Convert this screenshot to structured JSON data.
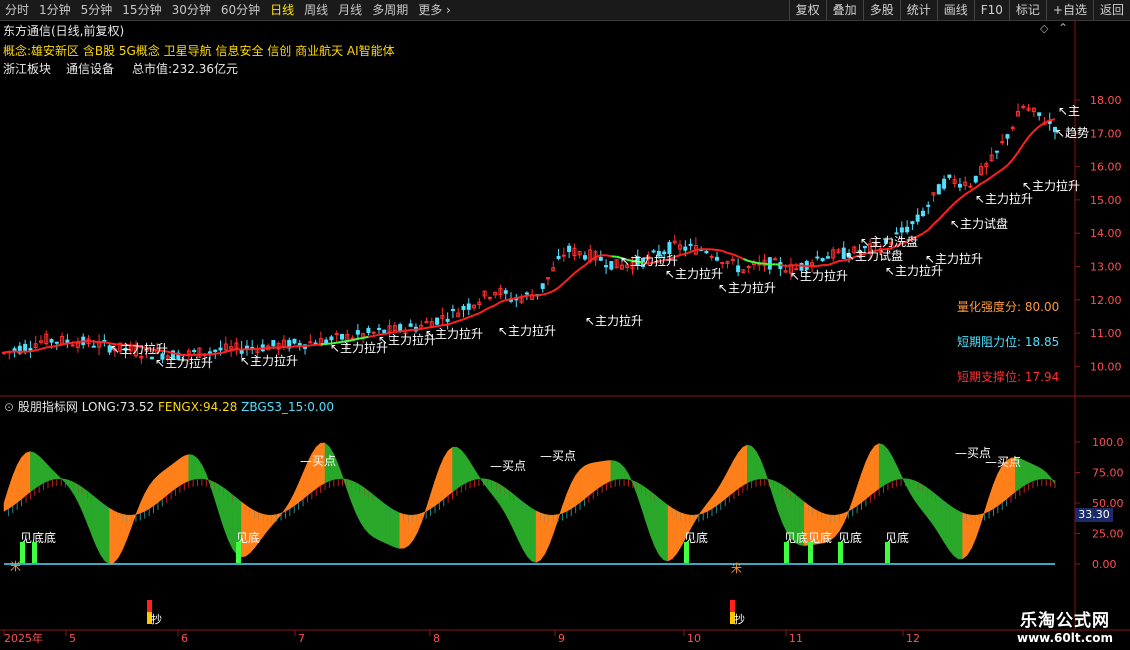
{
  "toolbar": {
    "periods": [
      "分时",
      "1分钟",
      "5分钟",
      "15分钟",
      "30分钟",
      "60分钟",
      "日线",
      "周线",
      "月线",
      "多周期",
      "更多"
    ],
    "active_period": "日线",
    "tools": [
      "复权",
      "叠加",
      "多股",
      "统计",
      "画线",
      "F10",
      "标记",
      "+自选",
      "返回"
    ]
  },
  "header": {
    "title": "东方通信(日线,前复权)",
    "concepts": "概念:雄安新区 含B股 5G概念 卫星导航 信息安全 信创 商业航天 AI智能体",
    "sector_label": "浙江板块",
    "industry": "通信设备",
    "market_cap": "总市值:232.36亿元"
  },
  "main_panel": {
    "indicators": [
      {
        "label": "量化强度分:",
        "value": "80.00",
        "color": "#ff9a3c"
      },
      {
        "label": "短期阻力位:",
        "value": "18.85",
        "color": "#4fe0ff"
      },
      {
        "label": "短期支撑位:",
        "value": "17.94",
        "color": "#ff3030"
      }
    ],
    "y_ticks": [
      "18.00",
      "17.00",
      "16.00",
      "15.00",
      "14.00",
      "13.00",
      "12.00",
      "11.00",
      "10.00"
    ],
    "annotations": [
      "主力拉升",
      "主力试盘",
      "主力洗盘",
      "趋势",
      "主"
    ]
  },
  "sub_panel": {
    "name": "股朋指标网",
    "items": [
      {
        "label": "LONG:",
        "value": "73.52",
        "color": "#e0e0e0"
      },
      {
        "label": "FENGX:",
        "value": "94.28",
        "color": "#ffd800"
      },
      {
        "label": "ZBGS3_15:",
        "value": "0.00",
        "color": "#4fe0ff"
      }
    ],
    "y_ticks": [
      "100.0",
      "75.00",
      "50.00",
      "25.00",
      "0.00"
    ],
    "current_value": "33.30",
    "labels": {
      "buy": "买点",
      "bottom": "见底",
      "see_bottom": "见底底",
      "chao": "抄",
      "mark": "米"
    }
  },
  "x_axis": {
    "labels": [
      "2025年",
      "5",
      "6",
      "7",
      "8",
      "9",
      "10",
      "11",
      "12"
    ]
  },
  "watermark": {
    "line1": "乐淘公式网",
    "line2": "www.60lt.com"
  },
  "colors": {
    "up": "#ff3030",
    "down": "#4fe0ff",
    "ma": "#ff2020",
    "ma_green": "#40ff40",
    "orange": "#ff7f1a",
    "green": "#2aa82a",
    "divider": "#8b1414"
  }
}
